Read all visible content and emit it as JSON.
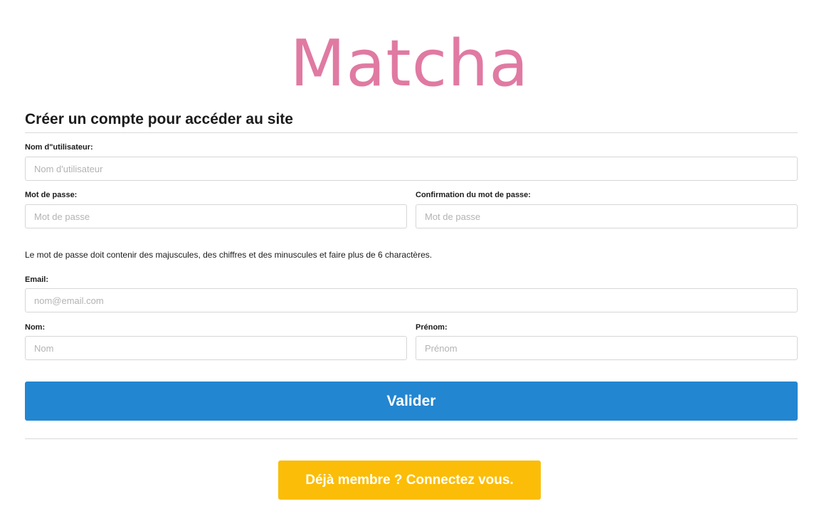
{
  "brand": {
    "logo_text": "Matcha",
    "color": "#e07aa2"
  },
  "form": {
    "title": "Créer un compte pour accéder au site",
    "username": {
      "label": "Nom d\"utilisateur:",
      "placeholder": "Nom d'utilisateur",
      "value": ""
    },
    "password": {
      "label": "Mot de passe:",
      "placeholder": "Mot de passe",
      "value": ""
    },
    "password_confirm": {
      "label": "Confirmation du mot de passe:",
      "placeholder": "Mot de passe",
      "value": ""
    },
    "password_help": "Le mot de passe doit contenir des majuscules, des chiffres et des minuscules et faire plus de 6 charactères.",
    "email": {
      "label": "Email:",
      "placeholder": "nom@email.com",
      "value": ""
    },
    "last_name": {
      "label": "Nom:",
      "placeholder": "Nom",
      "value": ""
    },
    "first_name": {
      "label": "Prénom:",
      "placeholder": "Prénom",
      "value": ""
    },
    "submit_label": "Valider",
    "submit_color": "#2386d1"
  },
  "login": {
    "label": "Déjà membre ? Connectez vous.",
    "color": "#fbbd08"
  }
}
